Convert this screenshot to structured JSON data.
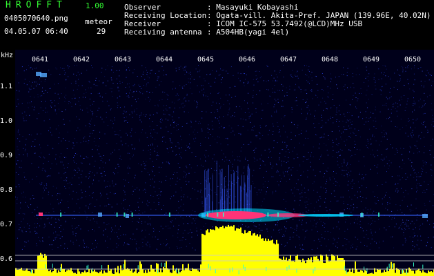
{
  "app": {
    "title": "HROFFT",
    "version": "1.00"
  },
  "file": {
    "name": "0405070640.png",
    "datetime": "04.05.07 06:40"
  },
  "meteor": {
    "label": "meteor",
    "count": "29"
  },
  "info": [
    {
      "label": "Observer",
      "value": ": Masayuki Kobayashi"
    },
    {
      "label": "Receiving Location",
      "value": ": Ogata-vill. Akita-Pref. JAPAN (139.96E, 40.02N)"
    },
    {
      "label": "Receiver",
      "value": ": ICOM IC-575 53.7492(@LCD)MHz USB"
    },
    {
      "label": "Receiving antenna",
      "value": ": A504HB(yagi 4el)"
    }
  ],
  "axis": {
    "y_unit": "kHz",
    "y_ticks": [
      "1.1",
      "1.0",
      "0.9",
      "0.8",
      "0.7",
      "0.6"
    ],
    "x_ticks": [
      "0641",
      "0642",
      "0643",
      "0644",
      "0645",
      "0646",
      "0647",
      "0648",
      "0649",
      "0650"
    ]
  },
  "colors": {
    "background": "#000000",
    "noise": "#1a2a9a",
    "header_green": "#33ff33",
    "activity": "#ffff00",
    "echo_core": "#ff3377"
  }
}
